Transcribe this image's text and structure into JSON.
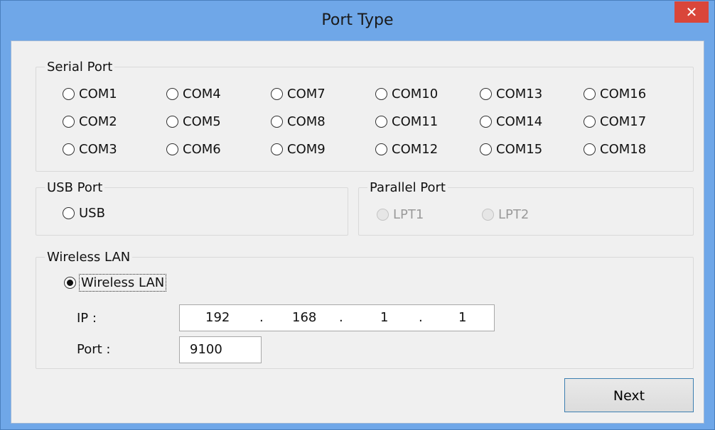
{
  "window": {
    "title": "Port Type",
    "close_glyph": "✕"
  },
  "serial": {
    "label": "Serial Port",
    "ports": [
      "COM1",
      "COM4",
      "COM7",
      "COM10",
      "COM13",
      "COM16",
      "COM2",
      "COM5",
      "COM8",
      "COM11",
      "COM14",
      "COM17",
      "COM3",
      "COM6",
      "COM9",
      "COM12",
      "COM15",
      "COM18"
    ]
  },
  "usb": {
    "label": "USB Port",
    "option": "USB"
  },
  "parallel": {
    "label": "Parallel Port",
    "options": [
      "LPT1",
      "LPT2"
    ]
  },
  "wireless": {
    "label": "Wireless LAN",
    "option": "Wireless LAN",
    "ip_label": "IP :",
    "ip": [
      "192",
      "168",
      "1",
      "1"
    ],
    "ip_separator": ".",
    "port_label": "Port :",
    "port_value": "9100"
  },
  "buttons": {
    "next": "Next"
  },
  "colors": {
    "titlebar": "#6fa7e8",
    "close": "#d9463a",
    "client": "#f0f0f0"
  }
}
